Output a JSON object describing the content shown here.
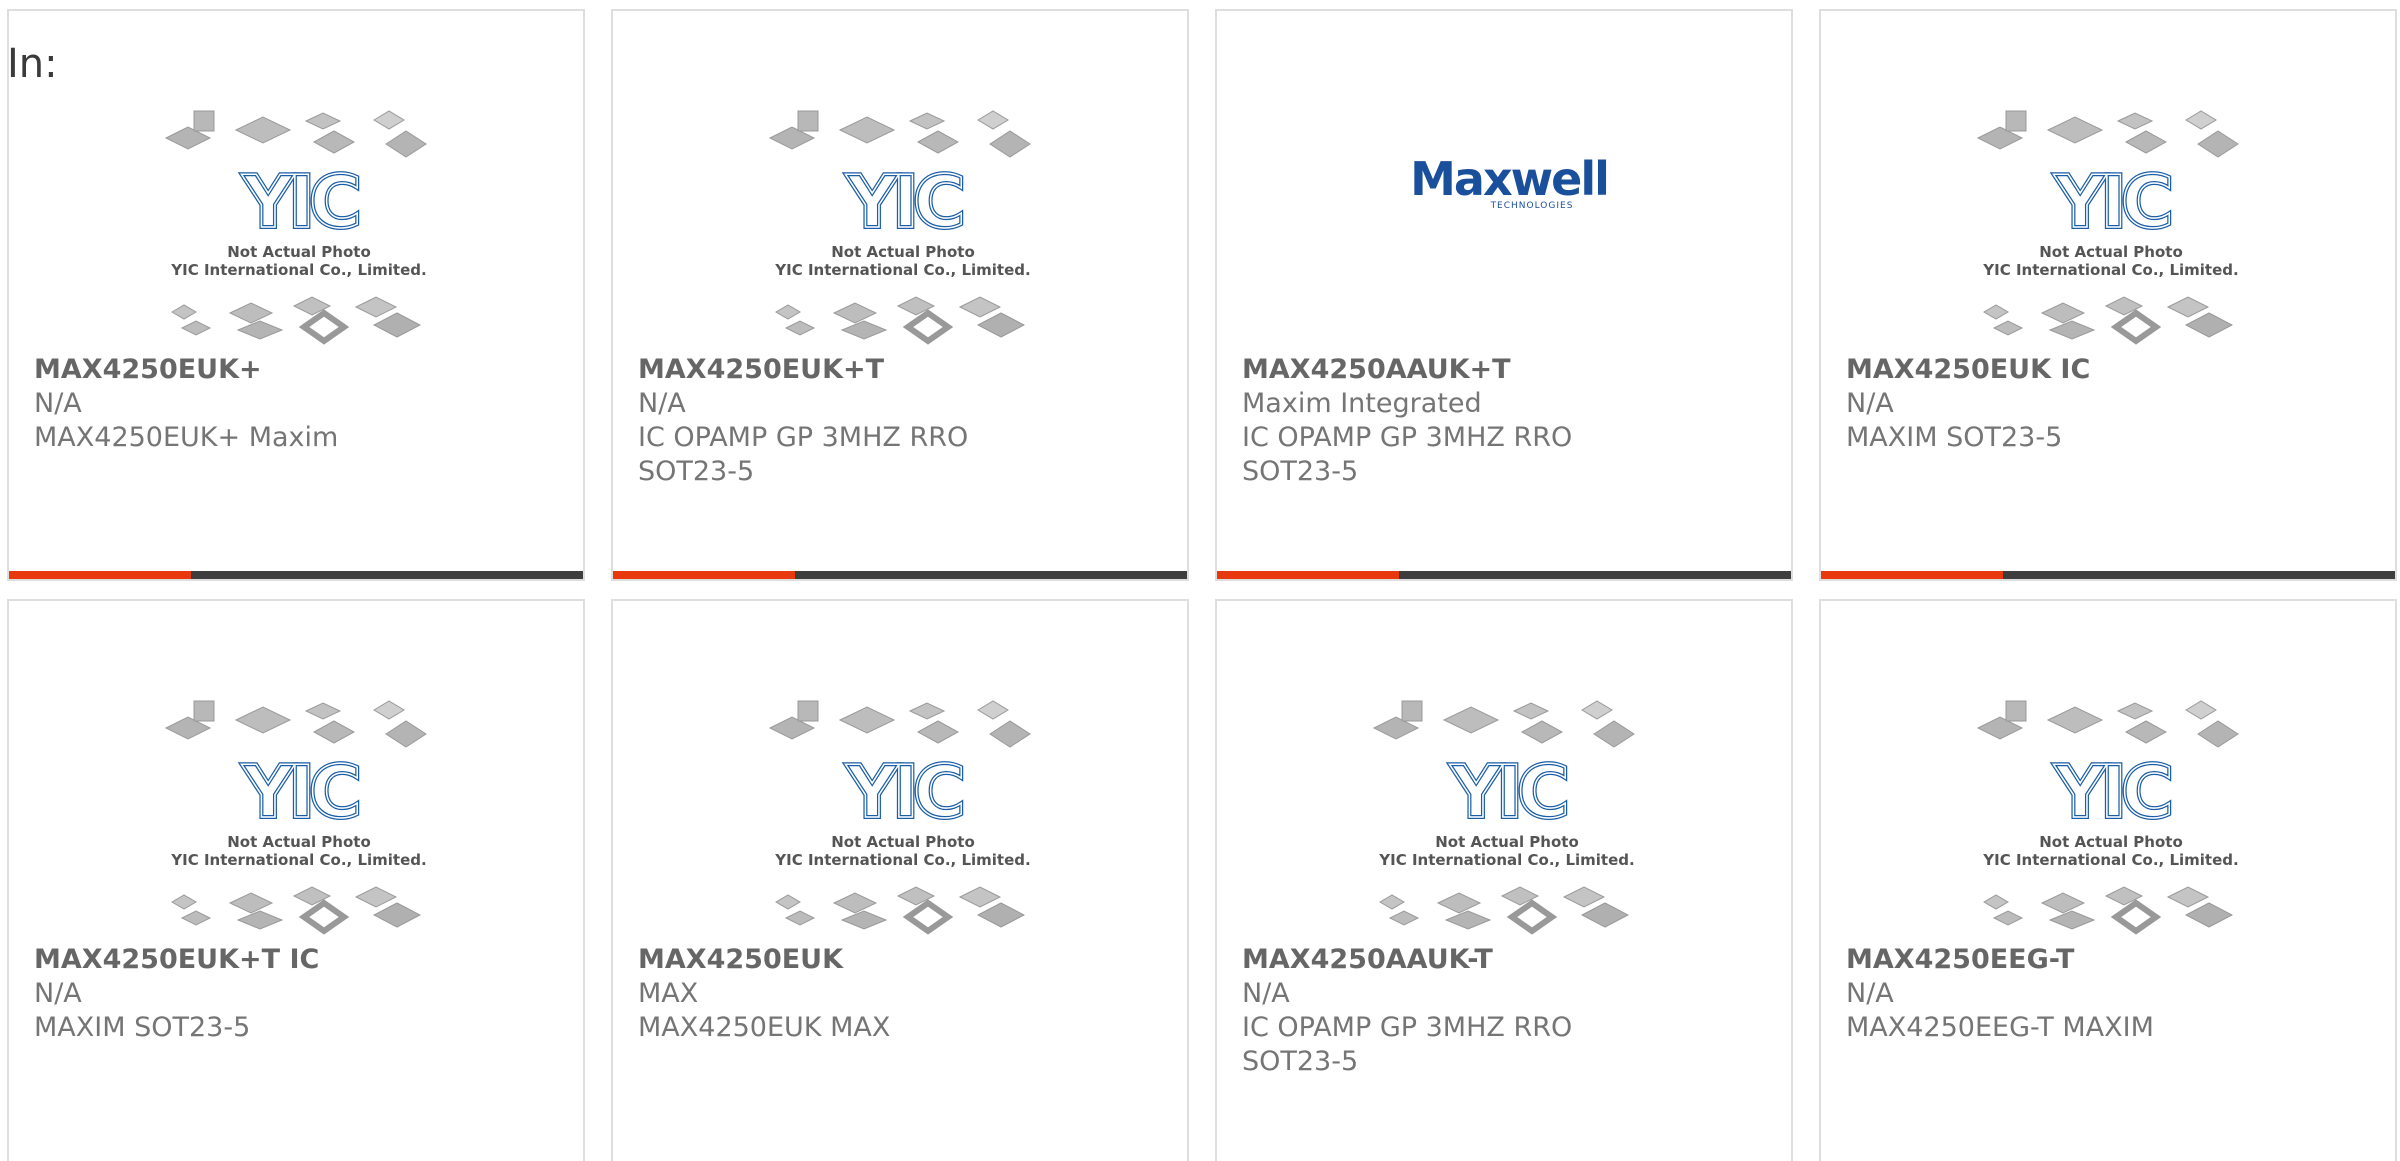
{
  "header": {
    "in_label": "In:"
  },
  "placeholder": {
    "line1": "Not Actual Photo",
    "line2": "YIC International Co., Limited.",
    "logo_text": "YIC"
  },
  "maxwell": {
    "logo_text": "Maxwell",
    "logo_sub": "TECHNOLOGIES"
  },
  "colors": {
    "accent": "#e8380d",
    "bar_dark": "#3d3d3d",
    "logo_blue": "#1a5ea8"
  },
  "products": [
    {
      "part": "MAX4250EUK+",
      "manufacturer": "N/A",
      "description": "MAX4250EUK+ Maxim",
      "image": "yic-placeholder"
    },
    {
      "part": "MAX4250EUK+T",
      "manufacturer": "N/A",
      "description": "IC OPAMP GP 3MHZ RRO SOT23-5",
      "image": "yic-placeholder"
    },
    {
      "part": "MAX4250AAUK+T",
      "manufacturer": "Maxim Integrated",
      "description": "IC OPAMP GP 3MHZ RRO SOT23-5",
      "image": "maxwell-logo"
    },
    {
      "part": "MAX4250EUK IC",
      "manufacturer": "N/A",
      "description": "MAXIM SOT23-5",
      "image": "yic-placeholder"
    },
    {
      "part": "MAX4250EUK+T IC",
      "manufacturer": "N/A",
      "description": "MAXIM SOT23-5",
      "image": "yic-placeholder"
    },
    {
      "part": "MAX4250EUK",
      "manufacturer": "MAX",
      "description": "MAX4250EUK MAX",
      "image": "yic-placeholder"
    },
    {
      "part": "MAX4250AAUK-T",
      "manufacturer": "N/A",
      "description": "IC OPAMP GP 3MHZ RRO SOT23-5",
      "image": "yic-placeholder"
    },
    {
      "part": "MAX4250EEG-T",
      "manufacturer": "N/A",
      "description": "MAX4250EEG-T MAXIM",
      "image": "yic-placeholder"
    }
  ]
}
